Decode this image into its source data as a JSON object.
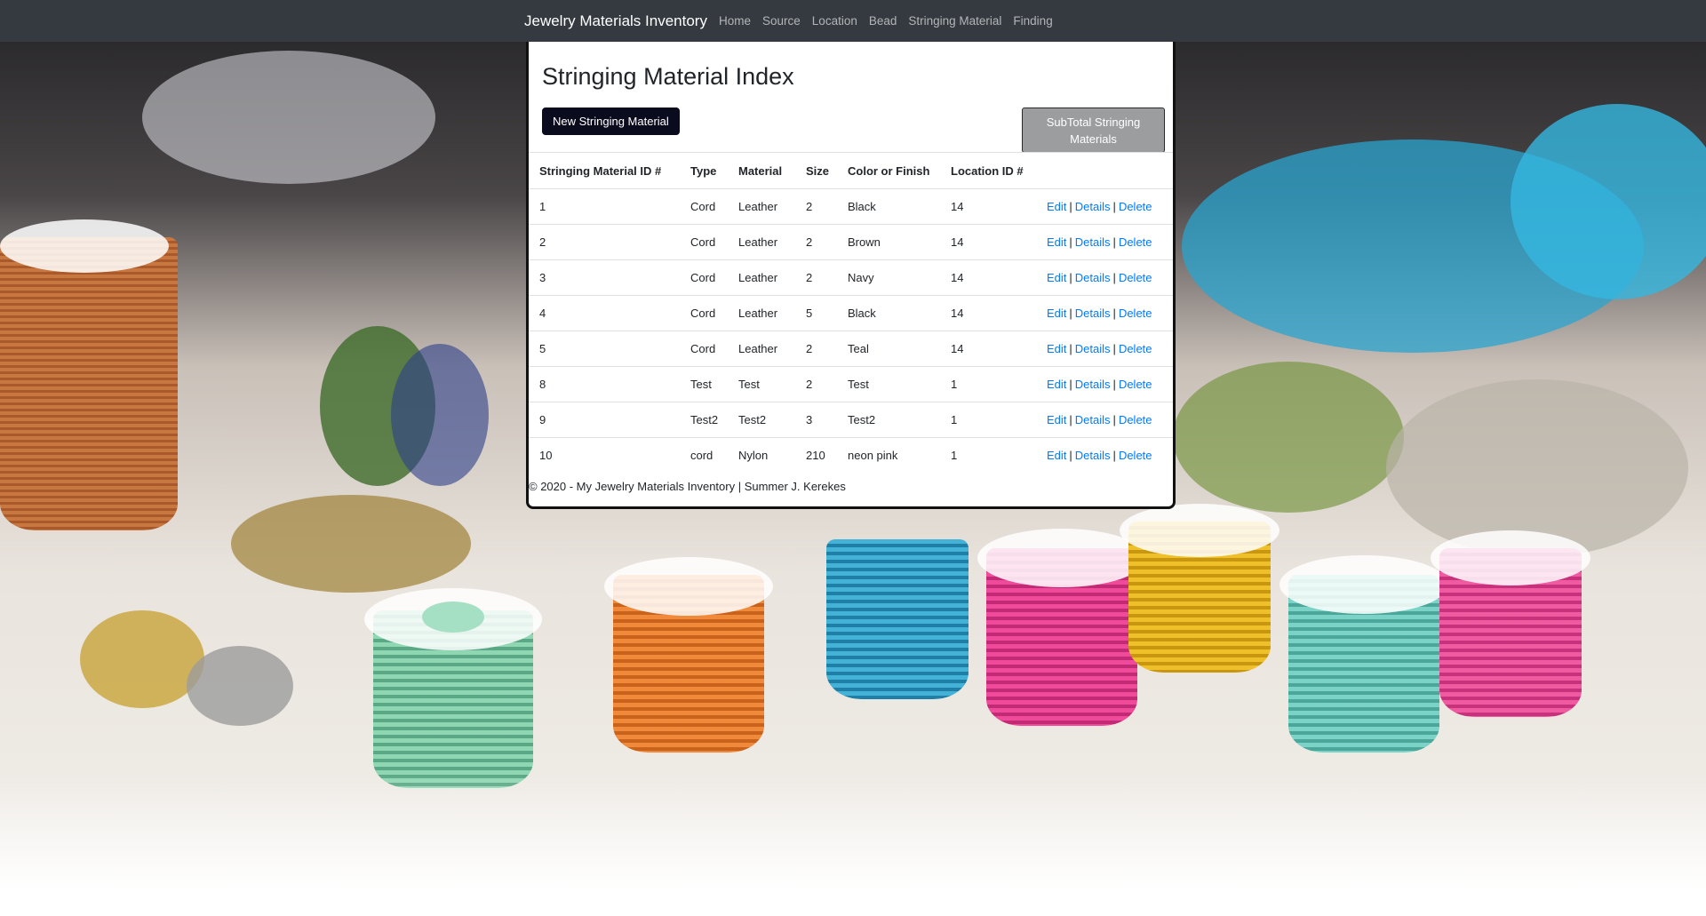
{
  "navbar": {
    "brand": "Jewelry Materials Inventory",
    "links": [
      "Home",
      "Source",
      "Location",
      "Bead",
      "Stringing Material",
      "Finding"
    ]
  },
  "page": {
    "title": "Stringing Material Index",
    "new_button": "New Stringing Material",
    "subtotal_button": "SubTotal Stringing Materials"
  },
  "table": {
    "headers": [
      "Stringing Material ID #",
      "Type",
      "Material",
      "Size",
      "Color or Finish",
      "Location ID #"
    ],
    "actions": {
      "edit": "Edit",
      "details": "Details",
      "delete": "Delete",
      "separator": "|"
    },
    "rows": [
      [
        "1",
        "Cord",
        "Leather",
        "2",
        "Black",
        "14"
      ],
      [
        "2",
        "Cord",
        "Leather",
        "2",
        "Brown",
        "14"
      ],
      [
        "3",
        "Cord",
        "Leather",
        "2",
        "Navy",
        "14"
      ],
      [
        "4",
        "Cord",
        "Leather",
        "5",
        "Black",
        "14"
      ],
      [
        "5",
        "Cord",
        "Leather",
        "2",
        "Teal",
        "14"
      ],
      [
        "8",
        "Test",
        "Test",
        "2",
        "Test",
        "1"
      ],
      [
        "9",
        "Test2",
        "Test2",
        "3",
        "Test2",
        "1"
      ],
      [
        "10",
        "cord",
        "Nylon",
        "210",
        "neon pink",
        "1"
      ]
    ]
  },
  "footer": {
    "text": "© 2020 - My Jewelry Materials Inventory | Summer J. Kerekes"
  },
  "colors": {
    "navbar": "#343a40",
    "link": "#007bff",
    "new_button": "#0b0b1e",
    "subtotal_button": "#9b9d9f"
  }
}
